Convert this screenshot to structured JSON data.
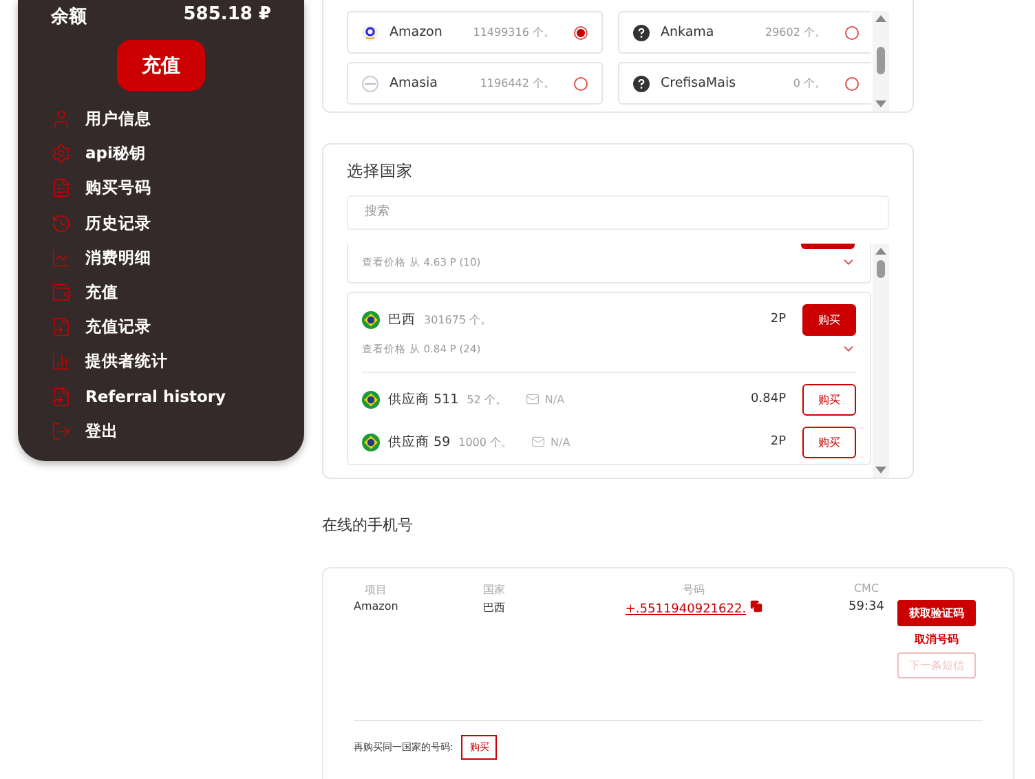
{
  "sidebar": {
    "balance_label": "余额",
    "balance": "585.18 ₽",
    "topup_button": "充值",
    "items": [
      {
        "label": "用户信息"
      },
      {
        "label": "api秘钥"
      },
      {
        "label": "购买号码"
      },
      {
        "label": "历史记录"
      },
      {
        "label": "消费明细"
      },
      {
        "label": "充值"
      },
      {
        "label": "充值记录"
      },
      {
        "label": "提供者统计"
      },
      {
        "label": "Referral history"
      },
      {
        "label": "登出"
      }
    ]
  },
  "services": [
    {
      "name": "Amazon",
      "count": "11499316 个。",
      "selected": true
    },
    {
      "name": "Ankama",
      "count": "29602 个。",
      "selected": false
    },
    {
      "name": "Amasia",
      "count": "1196442 个。",
      "selected": false
    },
    {
      "name": "CrefisaMais",
      "count": "0 个。",
      "selected": false
    }
  ],
  "country_panel": {
    "title": "选择国家",
    "search": {
      "placeholder": "搜索"
    },
    "previous_price_link": "查看价格 从 4.63 P (10)",
    "country": {
      "name": "巴西",
      "count": "301675 个。",
      "price": "2P",
      "buy": "购买",
      "price_link": "查看价格 从 0.84 P (24)",
      "expanded": true
    },
    "providers": [
      {
        "name": "供应商 511",
        "count": "52 个。",
        "contact": "N/A",
        "price": "0.84P",
        "buy": "购买"
      },
      {
        "name": "供应商 59",
        "count": "1000 个。",
        "contact": "N/A",
        "price": "2P",
        "buy": "购买"
      }
    ]
  },
  "online_numbers": {
    "title": "在线的手机号",
    "columns": [
      "项目",
      "国家",
      "号码",
      "CMC"
    ],
    "rows": [
      {
        "service": "Amazon",
        "country": "巴西",
        "number": "+.5511940921622.",
        "time": "59:34",
        "actions": [
          {
            "label": "获取验证码",
            "kind": "primary",
            "disabled": false
          },
          {
            "label": "取消号码",
            "kind": "link",
            "disabled": false
          },
          {
            "label": "下一条短信",
            "kind": "outline",
            "disabled": true
          }
        ]
      }
    ],
    "rebuy_label": "再购买同一国家的号码:",
    "rebuy_button": "购买"
  }
}
